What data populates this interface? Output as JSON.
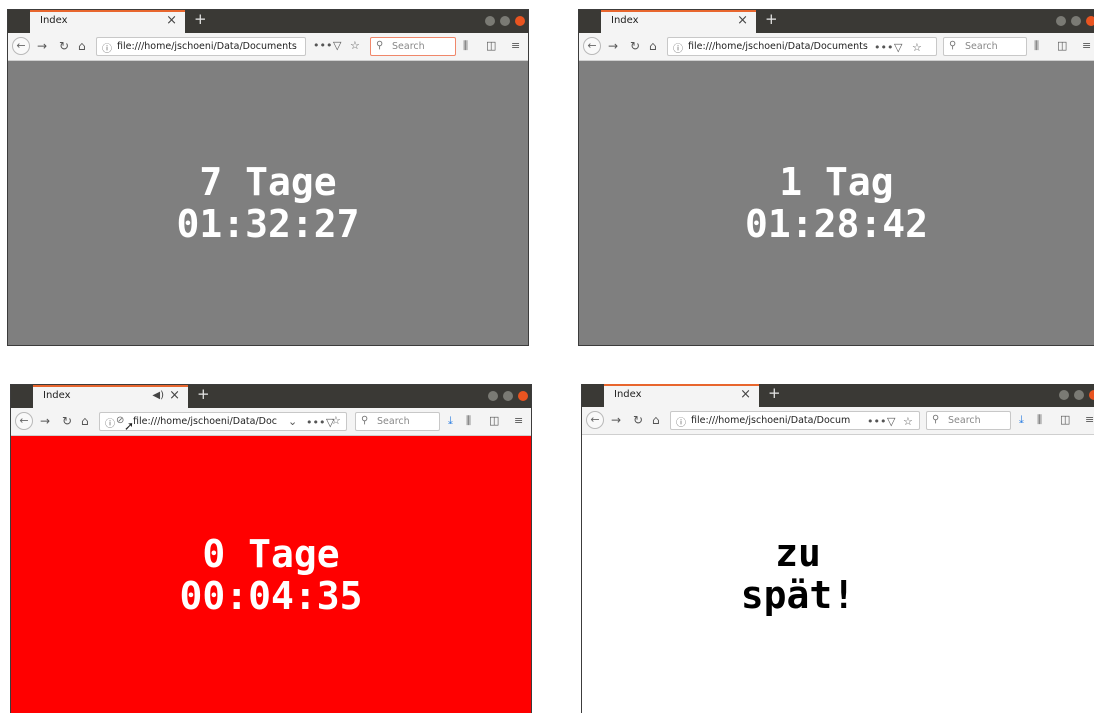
{
  "windows": [
    {
      "tab_title": "Index",
      "tab_close": "×",
      "new_tab": "+",
      "url": "file:///home/jschoeni/Data/Documents",
      "search_placeholder": "Search",
      "countdown_line1": "7 Tage",
      "countdown_line2": "01:32:27",
      "background_color": "#7f7f7f"
    },
    {
      "tab_title": "Index",
      "tab_close": "×",
      "new_tab": "+",
      "url": "file:///home/jschoeni/Data/Documents",
      "search_placeholder": "Search",
      "countdown_line1": "1 Tag",
      "countdown_line2": "01:28:42",
      "background_color": "#7f7f7f"
    },
    {
      "tab_title": "Index",
      "tab_close": "×",
      "new_tab": "+",
      "url": "file:///home/jschoeni/Data/Doc",
      "search_placeholder": "Search",
      "countdown_line1": "0 Tage",
      "countdown_line2": "00:04:35",
      "background_color": "#ff0000"
    },
    {
      "tab_title": "Index",
      "tab_close": "×",
      "new_tab": "+",
      "url": "file:///home/jschoeni/Data/Docum",
      "search_placeholder": "Search",
      "countdown_line1": "zu",
      "countdown_line2": "spät!",
      "background_color": "#ffffff"
    }
  ],
  "icons": {
    "back": "back-arrow-icon",
    "forward": "forward-arrow-icon",
    "reload": "reload-icon",
    "home": "home-icon",
    "info": "info-icon",
    "page_actions": "more-icon",
    "pocket": "pocket-icon",
    "bookmark": "star-icon",
    "library": "library-icon",
    "sidebar": "sidebar-icon",
    "menu": "hamburger-menu-icon",
    "download": "download-icon",
    "audio": "speaker-icon"
  },
  "colors": {
    "tab_accent": "#e8662e",
    "titlebar": "#3a3935",
    "grey_page": "#7f7f7f",
    "red_page": "#ff0000"
  }
}
